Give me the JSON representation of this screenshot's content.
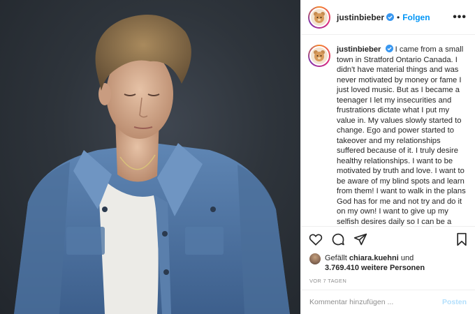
{
  "header": {
    "username": "justinbieber",
    "separator": "•",
    "follow_label": "Folgen",
    "more_label": "•••"
  },
  "caption": {
    "username": "justinbieber",
    "text": "I came from a small town in Stratford Ontario Canada. I didn't have material things and was never motivated by money or fame I just loved music. But as I became a teenager I let my insecurities and frustrations dictate what I put my value in. My values slowly started to change. Ego and power started to takeover and my relationships suffered because of it. I truly desire healthy relationships. I want to be motivated by truth and love. I want to be aware of my blind spots and learn from them! I want to walk in the plans God has for me and not try and do it on my own! I want to give up my selfish desires daily so I can be a good husband and future dad! I'm grateful that I am walking with Jesus who loves me"
  },
  "actions": {
    "like": "heart-icon",
    "comment": "comment-icon",
    "share": "share-icon",
    "save": "bookmark-icon"
  },
  "likes": {
    "prefix": "Gefällt",
    "liker": "chiara.kuehni",
    "conjunction": "und",
    "count": "3.769.410",
    "suffix": "weitere Personen"
  },
  "timestamp": "VOR 7 TAGEN",
  "comment": {
    "placeholder": "Kommentar hinzufügen ...",
    "post_label": "Posten"
  },
  "colors": {
    "accent": "#0095f6",
    "post_disabled": "#b2dffc",
    "text": "#262626",
    "muted": "#8e8e8e"
  }
}
